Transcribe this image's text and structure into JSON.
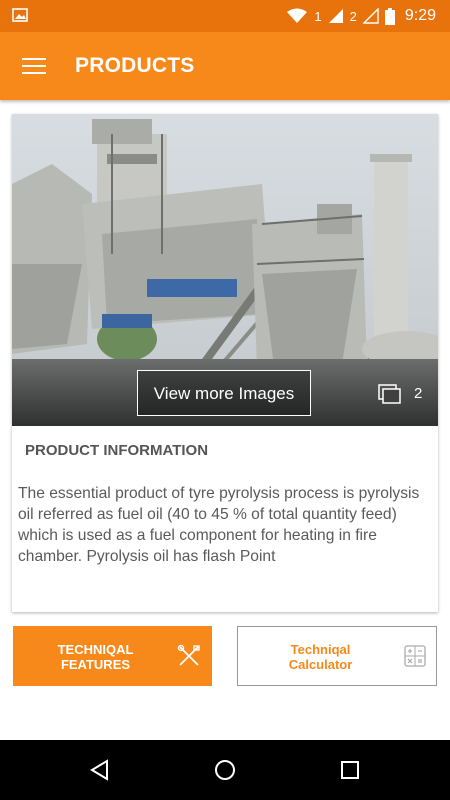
{
  "status_bar": {
    "sim1": "1",
    "sim2": "2",
    "time": "9:29",
    "icons": [
      "image-icon",
      "wifi-icon",
      "signal-icon",
      "battery-icon"
    ]
  },
  "app_bar": {
    "title": "PRODUCTS",
    "menu_icon": "menu-icon"
  },
  "product_card": {
    "view_more_label": "View more Images",
    "image_count": "2",
    "info_title": "PRODUCT INFORMATION",
    "info_text": "The essential product of tyre pyrolysis process is pyrolysis oil referred as fuel oil (40 to 45 % of total quantity feed) which is used as a fuel component for heating in fire chamber. Pyrolysis oil has flash Point"
  },
  "buttons": {
    "features_line1": "TECHNIQAL",
    "features_line2": "FEATURES",
    "calculator_line1": "Techniqal",
    "calculator_line2": "Calculator"
  },
  "colors": {
    "accent": "#f7891a",
    "status_bar": "#e8730c",
    "nav_bar": "#000000"
  }
}
